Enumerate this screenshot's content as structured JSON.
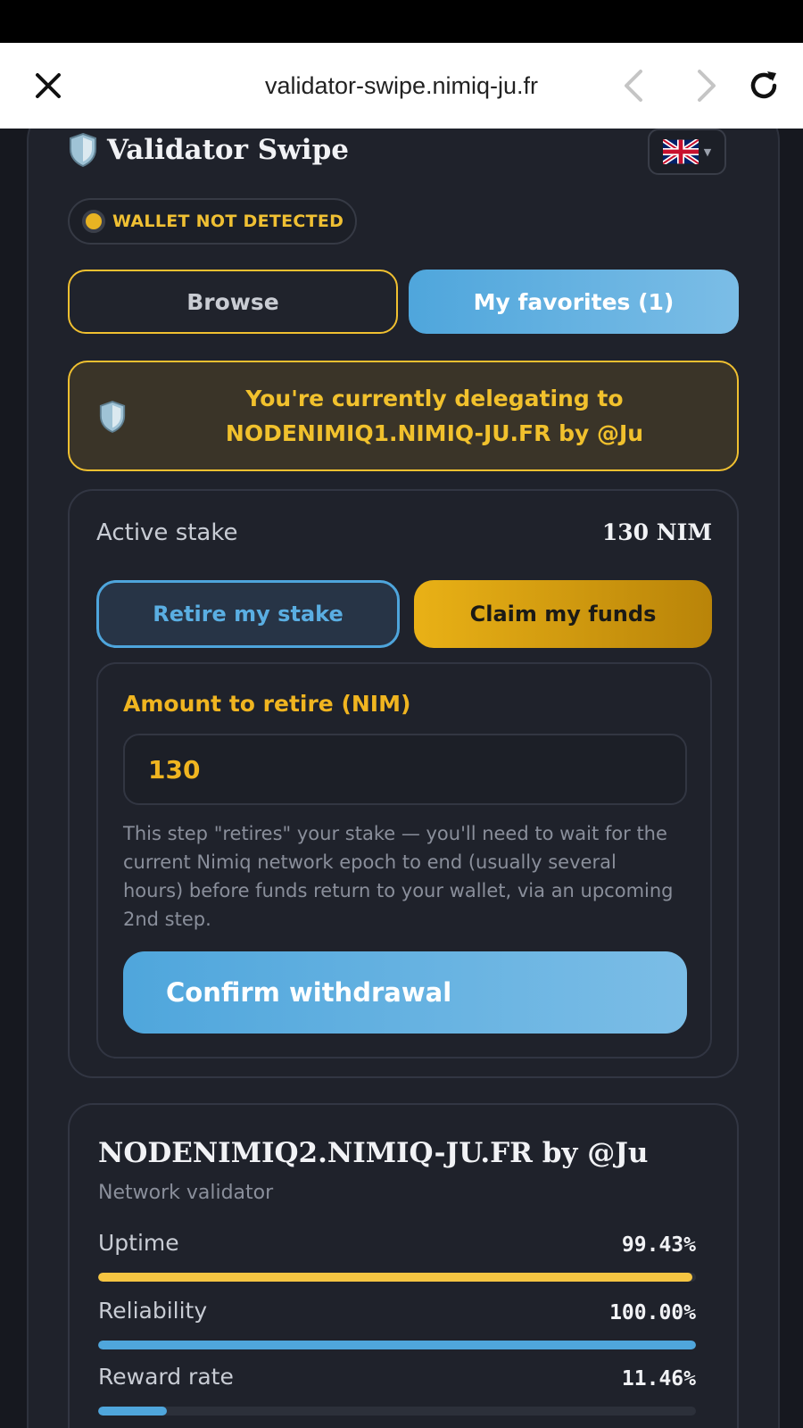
{
  "browser": {
    "url": "validator-swipe.nimiq-ju.fr"
  },
  "header": {
    "title": "Validator Swipe",
    "language_flag": "uk-flag-icon"
  },
  "wallet_status": {
    "text": "WALLET NOT DETECTED",
    "dot_color": "#e8b322"
  },
  "tabs": [
    {
      "label": "Browse",
      "active": false
    },
    {
      "label": "My favorites (1)",
      "active": true
    }
  ],
  "notice": {
    "line1": "You're currently delegating to",
    "line2": "NODENIMIQ1.NIMIQ-JU.FR by @Ju"
  },
  "stake": {
    "label": "Active stake",
    "value": "130 NIM",
    "retire_button": "Retire my stake",
    "claim_button": "Claim my funds",
    "amount_label": "Amount to retire (NIM)",
    "amount_value": "130",
    "help_text": "This step \"retires\" your stake — you'll need to wait for the current Nimiq network epoch to end (usually several hours) before funds return to your wallet, via an upcoming 2nd step.",
    "confirm_button": "Confirm withdrawal"
  },
  "validator": {
    "name": "NODENIMIQ2.NIMIQ-JU.FR by @Ju",
    "subtitle": "Network validator",
    "metrics": [
      {
        "label": "Uptime",
        "value": "99.43%",
        "fill": 0.9943,
        "color": "#f5c542"
      },
      {
        "label": "Reliability",
        "value": "100.00%",
        "fill": 1.0,
        "color": "#4fa6dc"
      },
      {
        "label": "Reward rate",
        "value": "11.46%",
        "fill": 0.1146,
        "color": "#4fa6dc"
      }
    ]
  },
  "colors": {
    "accent_gold": "#f0c030",
    "accent_blue": "#4fa6dc",
    "background": "#16181f"
  }
}
